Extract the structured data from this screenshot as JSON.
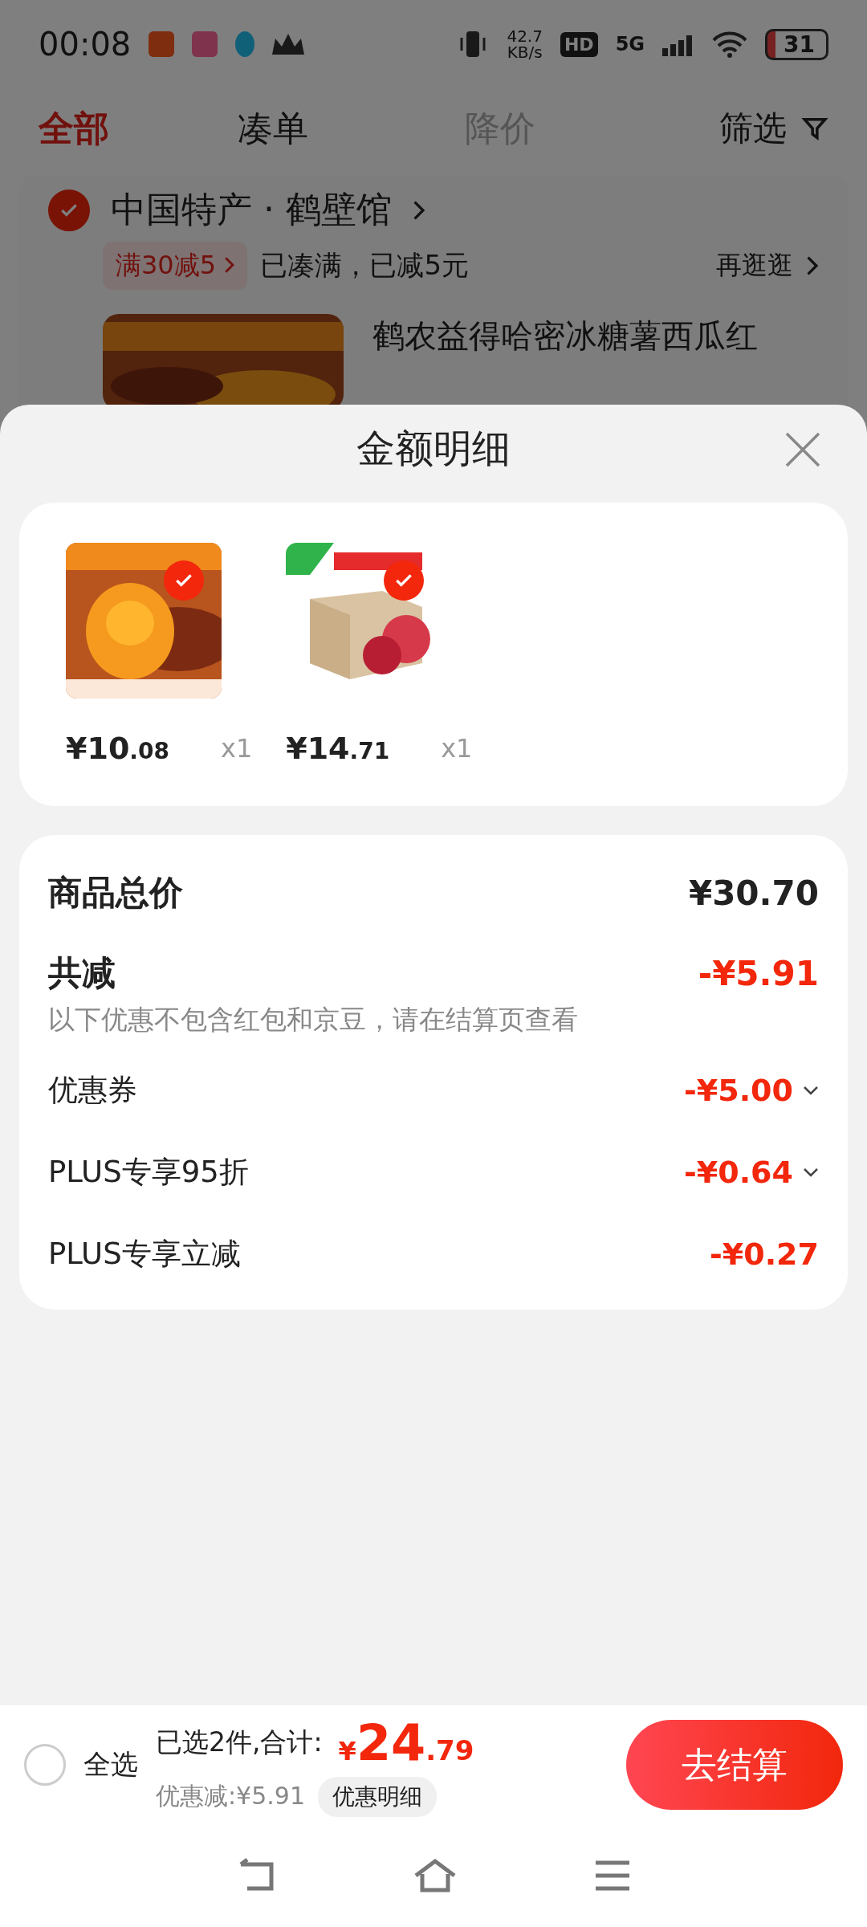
{
  "status_bar": {
    "time": "00:08",
    "net_speed": "42.7",
    "net_unit": "KB/s",
    "hd": "HD",
    "network": "5G",
    "battery": "31"
  },
  "tabs": [
    {
      "label": "全部",
      "selected": true,
      "disabled": false
    },
    {
      "label": "凑单",
      "selected": false,
      "disabled": false
    },
    {
      "label": "降价",
      "selected": false,
      "disabled": true
    }
  ],
  "filter": {
    "label": "筛选"
  },
  "store": {
    "name": "中国特产 · 鹤壁馆",
    "checked": true,
    "promo_tag": "满30减5",
    "promo_text": "已凑满，已减5元",
    "more": "再逛逛",
    "product_title": "鹤农益得哈密冰糖薯西瓜红"
  },
  "sheet": {
    "title": "金额明细",
    "items": [
      {
        "kind": "picture",
        "checked": true,
        "price_int": "¥10",
        "price_dec": ".08",
        "qty": "x1"
      },
      {
        "kind": "picture",
        "checked": true,
        "price_int": "¥14",
        "price_dec": ".71",
        "qty": "x1"
      }
    ],
    "total": {
      "label": "商品总价",
      "value": "¥30.70"
    },
    "discount": {
      "label": "共减",
      "value": "-¥5.91",
      "note": "以下优惠不包含红包和京豆，请在结算页查看"
    },
    "rows": [
      {
        "label": "优惠券",
        "value": "-¥5.00",
        "expandable": true
      },
      {
        "label": "PLUS专享95折",
        "value": "-¥0.64",
        "expandable": true
      },
      {
        "label": "PLUS专享立减",
        "value": "-¥0.27",
        "expandable": false
      }
    ]
  },
  "footer": {
    "select_all": {
      "label": "全选",
      "checked": false
    },
    "summary": "已选2件,合计:",
    "currency": "¥",
    "amount_int": "24",
    "amount_dec": ".79",
    "saved": "优惠减:¥5.91",
    "detail_button": "优惠明细",
    "checkout": "去结算"
  }
}
